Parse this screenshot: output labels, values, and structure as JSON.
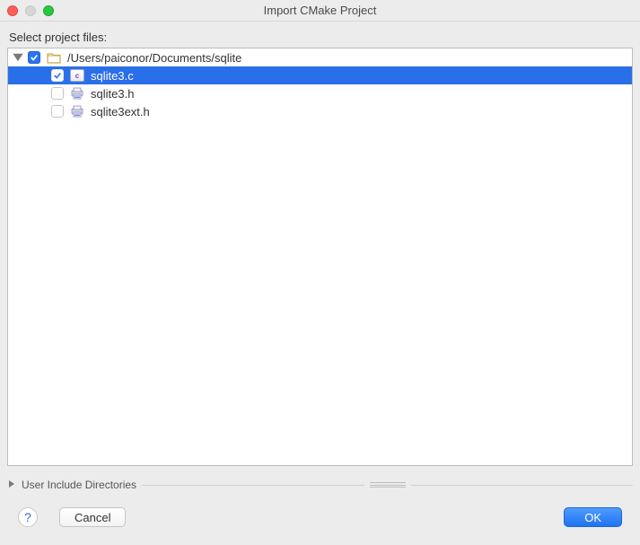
{
  "window": {
    "title": "Import CMake Project"
  },
  "labels": {
    "select_files": "Select project files:",
    "user_include": "User Include Directories"
  },
  "tree": {
    "root": {
      "path": "/Users/paiconor/Documents/sqlite",
      "checked": true,
      "expanded": true
    },
    "files": [
      {
        "name": "sqlite3.c",
        "checked": true,
        "selected": true
      },
      {
        "name": "sqlite3.h",
        "checked": false,
        "selected": false
      },
      {
        "name": "sqlite3ext.h",
        "checked": false,
        "selected": false
      }
    ]
  },
  "buttons": {
    "help": "?",
    "cancel": "Cancel",
    "ok": "OK"
  }
}
